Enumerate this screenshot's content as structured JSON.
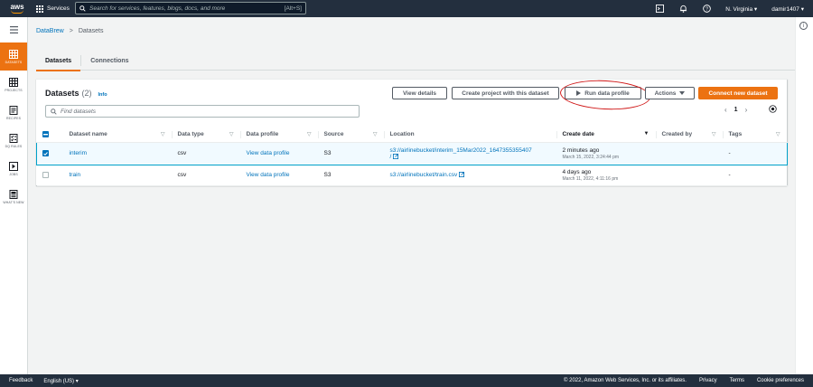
{
  "topnav": {
    "logo": "aws",
    "services": "Services",
    "search_placeholder": "Search for services, features, blogs, docs, and more",
    "search_shortcut": "[Alt+S]",
    "region": "N. Virginia",
    "user": "damir1407"
  },
  "rail": {
    "items": [
      {
        "label": "DATASETS",
        "active": true
      },
      {
        "label": "PROJECTS"
      },
      {
        "label": "RECIPES"
      },
      {
        "label": "DQ RULES"
      },
      {
        "label": "JOBS"
      },
      {
        "label": "WHAT'S NEW"
      }
    ]
  },
  "breadcrumb": {
    "root": "DataBrew",
    "current": "Datasets"
  },
  "tabs": [
    {
      "label": "Datasets"
    },
    {
      "label": "Connections"
    }
  ],
  "panel": {
    "title": "Datasets",
    "count": "(2)",
    "info": "Info",
    "buttons": {
      "view_details": "View details",
      "create_project": "Create project with this dataset",
      "run_profile": "Run data profile",
      "actions": "Actions",
      "connect": "Connect new dataset"
    },
    "find_placeholder": "Find datasets",
    "page": "1"
  },
  "table": {
    "columns": [
      "Dataset name",
      "Data type",
      "Data profile",
      "Source",
      "Location",
      "Create date",
      "Created by",
      "Tags"
    ],
    "rows": [
      {
        "name": "interim",
        "type": "csv",
        "profile": "View data profile",
        "source": "S3",
        "location_line1": "s3://airlinebucket/interim_15Mar2022_1647355355407",
        "location_line2": "/",
        "date_main": "2 minutes ago",
        "date_sub": "March 15, 2022, 3:24:44 pm",
        "created_by": "",
        "tags": "-"
      },
      {
        "name": "train",
        "type": "csv",
        "profile": "View data profile",
        "source": "S3",
        "location_line1": "s3://airlinebucket/train.csv",
        "location_line2": "",
        "date_main": "4 days ago",
        "date_sub": "March 11, 2022, 4:11:16 pm",
        "created_by": "",
        "tags": "-"
      }
    ]
  },
  "footer": {
    "feedback": "Feedback",
    "language": "English (US)",
    "copyright": "© 2022, Amazon Web Services, Inc. or its affiliates.",
    "privacy": "Privacy",
    "terms": "Terms",
    "cookies": "Cookie preferences"
  },
  "colors": {
    "nav": "#232f3e",
    "accent": "#ec7211",
    "link": "#0073bb",
    "annotation": "#d01919"
  }
}
